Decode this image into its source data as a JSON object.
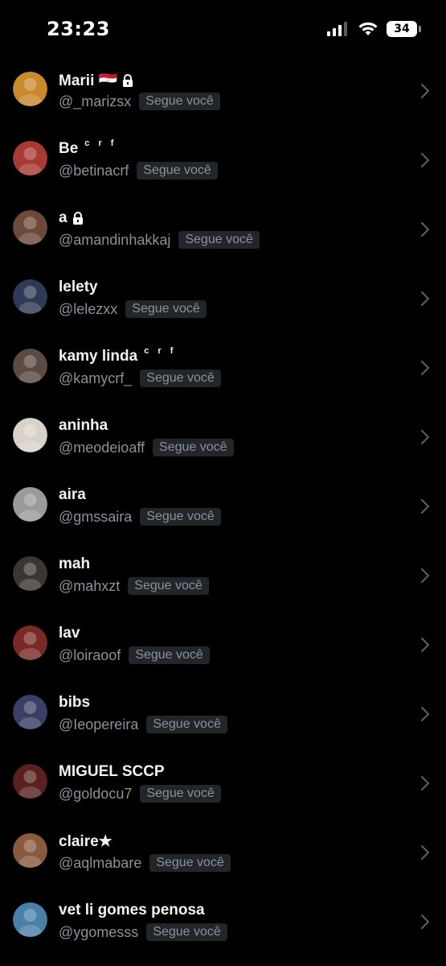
{
  "status_bar": {
    "time": "23:23",
    "battery": "34"
  },
  "follow_badge": "Segue você",
  "users": [
    {
      "name": "Marii 🇪🇬",
      "handle": "@_marizsx",
      "locked": true,
      "sup": "",
      "avatar_color": "#c9892e"
    },
    {
      "name": "Be",
      "sup": "c r f",
      "handle": "@betinacrf",
      "locked": false,
      "avatar_color": "#a83a34"
    },
    {
      "name": "a",
      "handle": "@amandinhakkaj",
      "locked": true,
      "sup": "",
      "avatar_color": "#6b4a3a"
    },
    {
      "name": "lelety",
      "handle": "@lelezxx",
      "locked": false,
      "sup": "",
      "avatar_color": "#2e3a55"
    },
    {
      "name": "kamy linda",
      "sup": "c r f",
      "handle": "@kamycrf_",
      "locked": false,
      "avatar_color": "#5a4a42"
    },
    {
      "name": "aninha",
      "handle": "@meodeioaff",
      "locked": false,
      "sup": "",
      "avatar_color": "#d8d2c8"
    },
    {
      "name": "aira",
      "handle": "@gmssaira",
      "locked": false,
      "sup": "",
      "avatar_color": "#9a9a9a"
    },
    {
      "name": "mah",
      "handle": "@mahxzt",
      "locked": false,
      "sup": "",
      "avatar_color": "#3a3633"
    },
    {
      "name": "lav",
      "handle": "@loiraoof",
      "locked": false,
      "sup": "",
      "avatar_color": "#7a2a26"
    },
    {
      "name": "bibs",
      "handle": "@Ieopereira",
      "locked": false,
      "sup": "",
      "avatar_color": "#3a3f66"
    },
    {
      "name": "MIGUEL SCCP",
      "handle": "@goldocu7",
      "locked": false,
      "sup": "",
      "avatar_color": "#5a2020"
    },
    {
      "name": "claire★",
      "handle": "@aqlmabare",
      "locked": false,
      "sup": "",
      "avatar_color": "#8a5a40"
    },
    {
      "name": "vet li gomes penosa",
      "handle": "@ygomesss",
      "locked": false,
      "sup": "",
      "avatar_color": "#4a7fa8"
    }
  ]
}
